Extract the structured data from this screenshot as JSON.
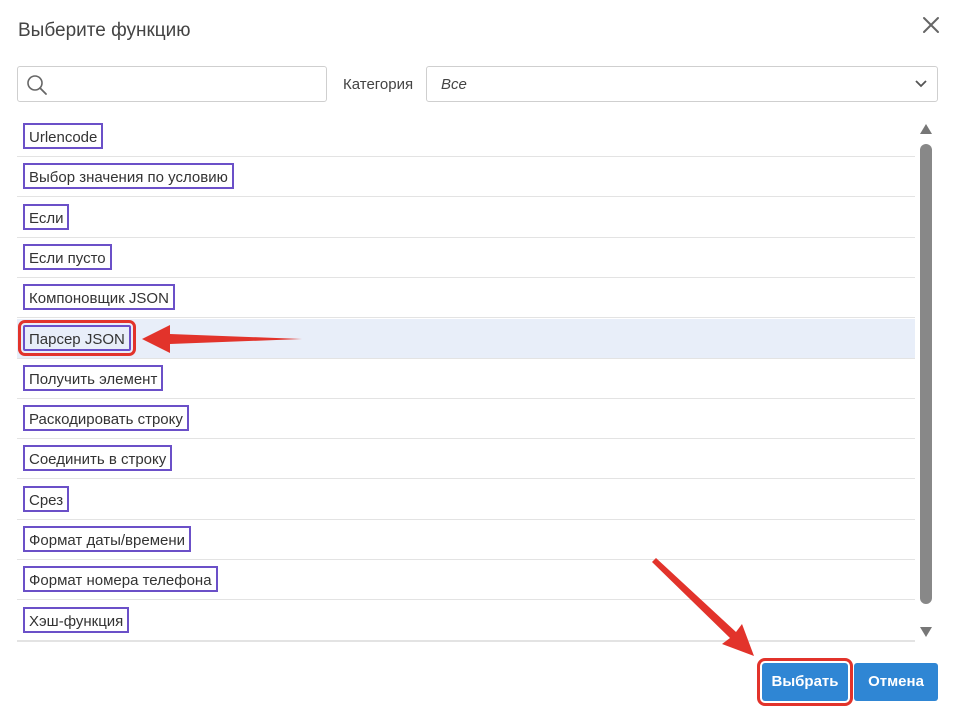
{
  "dialog": {
    "title": "Выберите функцию",
    "close_icon": "close-icon"
  },
  "search": {
    "value": "",
    "placeholder": "",
    "icon": "search-icon"
  },
  "category": {
    "label": "Категория",
    "selected": "Все",
    "icon": "chevron-down-icon"
  },
  "functions": [
    "Urlencode",
    "Выбор значения по условию",
    "Если",
    "Если пусто",
    "Компоновщик JSON",
    "Парсер JSON",
    "Получить элемент",
    "Раскодировать строку",
    "Соединить в строку",
    "Срез",
    "Формат даты/времени",
    "Формат номера телефона",
    "Хэш-функция"
  ],
  "selected_function": "Парсер JSON",
  "buttons": {
    "select": "Выбрать",
    "cancel": "Отмена"
  },
  "colors": {
    "accent": "#2f86d4",
    "highlight": "#e2332b",
    "label_border": "#6b50c8",
    "selected_row": "#e8eef9"
  }
}
